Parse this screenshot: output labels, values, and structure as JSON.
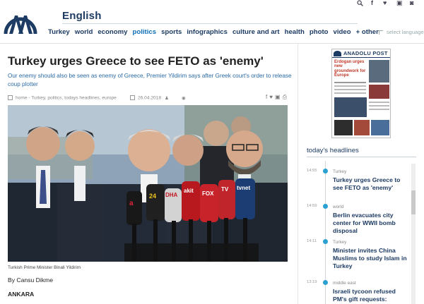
{
  "header": {
    "edition": "English",
    "nav": [
      {
        "label": "Turkey",
        "active": false
      },
      {
        "label": "world",
        "active": false
      },
      {
        "label": "economy",
        "active": false
      },
      {
        "label": "politics",
        "active": true
      },
      {
        "label": "sports",
        "active": false
      },
      {
        "label": "infographics",
        "active": false
      },
      {
        "label": "culture and art",
        "active": false
      },
      {
        "label": "health",
        "active": false
      },
      {
        "label": "photo",
        "active": false
      },
      {
        "label": "video",
        "active": false
      },
      {
        "label": "+ other",
        "active": false
      }
    ],
    "language_label": "select language",
    "top_icons": [
      "search-icon",
      "facebook-icon",
      "twitter-icon",
      "youtube-icon",
      "instagram-icon"
    ]
  },
  "article": {
    "headline": "Turkey urges Greece to see FETO as 'enemy'",
    "summary": "Our enemy should also be seen as enemy of Greece, Premier Yildirim says after Greek court's order to release coup plotter",
    "tags": "home - Turkey, politics, todays headlines, europe",
    "date": "26.04.2018",
    "share_icons": [
      "facebook-icon",
      "twitter-icon",
      "linkedin-icon",
      "print-icon"
    ],
    "photo_caption": "Turkish Prime Minister Binali Yildirim",
    "byline": "By Cansu Dikme",
    "dateline": "ANKARA",
    "mic_labels": [
      "a",
      "24",
      "DHA",
      "akit",
      "FOX",
      "TV",
      "tvnet"
    ]
  },
  "sidebar": {
    "epaper": {
      "masthead": "ANADOLU POST",
      "lead": "Erdogan urges new groundwork for Europe"
    },
    "headlines_title": "today's headlines",
    "headlines": [
      {
        "time": "14:55",
        "category": "Turkey",
        "title": "Turkey urges Greece to see FETO as 'enemy'"
      },
      {
        "time": "14:59",
        "category": "world",
        "title": "Berlin evacuates city center for WWII bomb disposal"
      },
      {
        "time": "14:11",
        "category": "Turkey",
        "title": "Minister invites China Muslims to study Islam in Turkey"
      },
      {
        "time": "13:19",
        "category": "middle east",
        "title": "Israeli tycoon refused PM's gift requests: Haaretz"
      }
    ]
  },
  "colors": {
    "brand_navy": "#1d3b63",
    "link_blue": "#2b6aa5",
    "timeline_dot": "#2aa1d0",
    "photo_sky": "#8fa3b8"
  }
}
